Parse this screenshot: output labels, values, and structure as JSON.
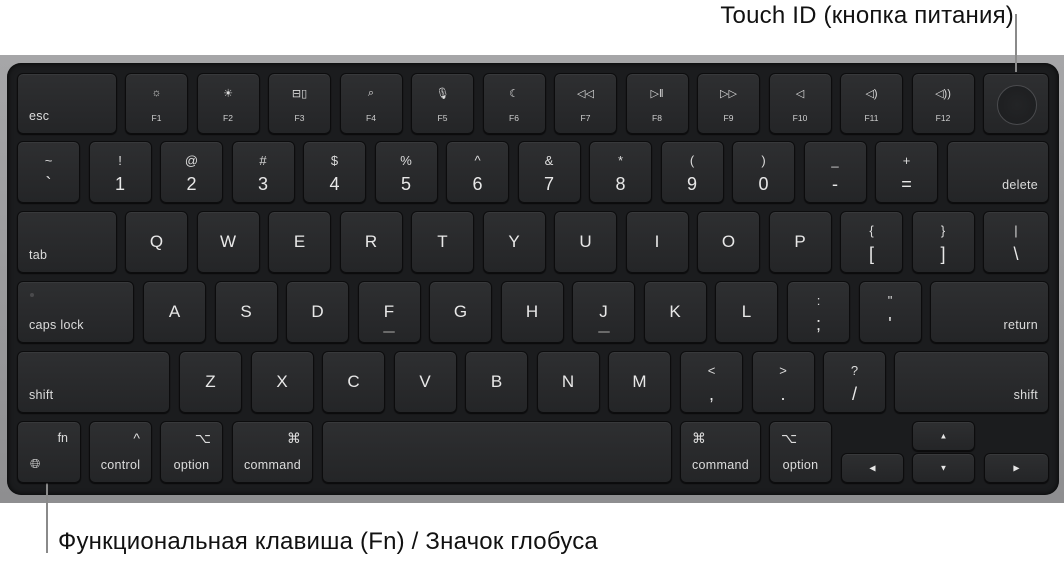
{
  "annotations": {
    "touch_id": "Touch ID (кнопка питания)",
    "fn_globe": "Функциональная клавиша (Fn) / Значок глобуса"
  },
  "keyboard": {
    "function_row": {
      "esc": "esc",
      "keys": [
        {
          "icon": "brightness-down-icon",
          "glyph": "☼",
          "label": "F1"
        },
        {
          "icon": "brightness-up-icon",
          "glyph": "☀",
          "label": "F2"
        },
        {
          "icon": "mission-control-icon",
          "glyph": "⊟▯",
          "label": "F3"
        },
        {
          "icon": "search-icon",
          "glyph": "⌕",
          "label": "F4"
        },
        {
          "icon": "microphone-icon",
          "glyph": "🎙︎",
          "label": "F5"
        },
        {
          "icon": "moon-icon",
          "glyph": "☾",
          "label": "F6"
        },
        {
          "icon": "rewind-icon",
          "glyph": "◁◁",
          "label": "F7"
        },
        {
          "icon": "play-pause-icon",
          "glyph": "▷‖",
          "label": "F8"
        },
        {
          "icon": "fast-forward-icon",
          "glyph": "▷▷",
          "label": "F9"
        },
        {
          "icon": "mute-icon",
          "glyph": "◁",
          "label": "F10"
        },
        {
          "icon": "volume-down-icon",
          "glyph": "◁)",
          "label": "F11"
        },
        {
          "icon": "volume-up-icon",
          "glyph": "◁))",
          "label": "F12"
        }
      ],
      "touch_id_icon": "touch-id-icon"
    },
    "number_row": {
      "keys": [
        {
          "top": "~",
          "bottom": "`"
        },
        {
          "top": "!",
          "bottom": "1"
        },
        {
          "top": "@",
          "bottom": "2"
        },
        {
          "top": "#",
          "bottom": "3"
        },
        {
          "top": "$",
          "bottom": "4"
        },
        {
          "top": "%",
          "bottom": "5"
        },
        {
          "top": "^",
          "bottom": "6"
        },
        {
          "top": "&",
          "bottom": "7"
        },
        {
          "top": "*",
          "bottom": "8"
        },
        {
          "top": "(",
          "bottom": "9"
        },
        {
          "top": ")",
          "bottom": "0"
        },
        {
          "top": "_",
          "bottom": "-"
        },
        {
          "top": "+",
          "bottom": "="
        }
      ],
      "delete": "delete"
    },
    "top_row": {
      "tab": "tab",
      "letters": [
        "Q",
        "W",
        "E",
        "R",
        "T",
        "Y",
        "U",
        "I",
        "O",
        "P"
      ],
      "symbols": [
        {
          "top": "{",
          "bottom": "["
        },
        {
          "top": "}",
          "bottom": "]"
        },
        {
          "top": "|",
          "bottom": "\\"
        }
      ]
    },
    "home_row": {
      "caps_lock": "caps lock",
      "letters": [
        "A",
        "S",
        "D",
        "F",
        "G",
        "H",
        "J",
        "K",
        "L"
      ],
      "symbols": [
        {
          "top": ":",
          "bottom": ";"
        },
        {
          "top": "\"",
          "bottom": "'"
        }
      ],
      "return": "return"
    },
    "bottom_row": {
      "shift_left": "shift",
      "letters": [
        "Z",
        "X",
        "C",
        "V",
        "B",
        "N",
        "M"
      ],
      "symbols": [
        {
          "top": "<",
          "bottom": ","
        },
        {
          "top": ">",
          "bottom": "."
        },
        {
          "top": "?",
          "bottom": "/"
        }
      ],
      "shift_right": "shift"
    },
    "modifier_row": {
      "fn": "fn",
      "globe_glyph": "🌐︎",
      "control": {
        "label": "control",
        "symbol": "^"
      },
      "option_left": {
        "label": "option",
        "symbol": "⌥"
      },
      "command_left": {
        "label": "command",
        "symbol": "⌘"
      },
      "command_right": {
        "label": "command",
        "symbol": "⌘"
      },
      "option_right": {
        "label": "option",
        "symbol": "⌥"
      },
      "arrows": {
        "left": "◀",
        "up": "▲",
        "down": "▼",
        "right": "▶"
      }
    }
  }
}
